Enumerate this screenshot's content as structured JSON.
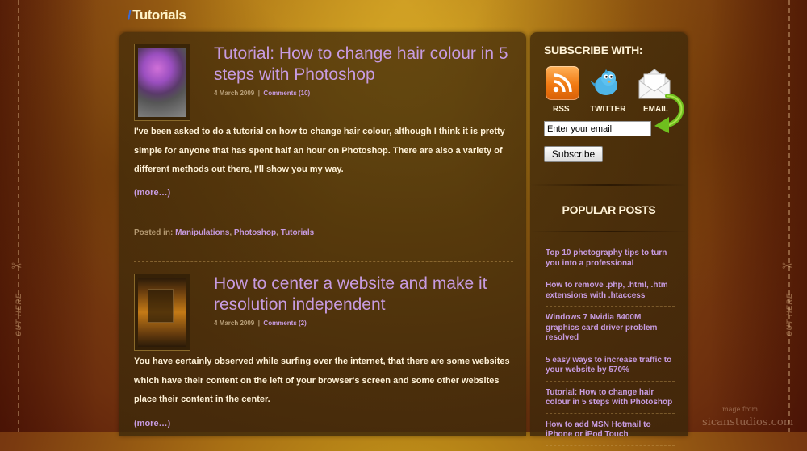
{
  "page": {
    "heading": "Tutorials"
  },
  "posts": [
    {
      "title": "Tutorial: How to change hair colour in 5 steps with Photoshop",
      "date": "4 March 2009",
      "comments": "Comments (10)",
      "excerpt": "I've been asked to do a tutorial on how to change hair colour, although I think it is pretty simple for anyone that has spent half an hour on Photoshop. There are also a variety of different methods out there, I'll show you my way.",
      "more": "(more…)",
      "posted_in_label": "Posted in:",
      "categories": [
        "Manipulations",
        "Photoshop",
        "Tutorials"
      ]
    },
    {
      "title": "How to center a website and make it resolution independent",
      "date": "4 March 2009",
      "comments": "Comments (2)",
      "excerpt": "You have certainly observed while surfing over the internet, that there are some websites which have their content on the left of your browser's screen and some other websites place their content in the center.",
      "more": "(more…)"
    }
  ],
  "sidebar": {
    "subscribe_title": "SUBSCRIBE WITH:",
    "options": {
      "rss": "RSS",
      "twitter": "TWITTER",
      "email": "EMAIL"
    },
    "email_value": "Enter your email",
    "subscribe_button": "Subscribe",
    "popular_title": "POPULAR POSTS",
    "popular_posts": [
      "Top 10 photography tips to turn you into a professional",
      "How to remove .php, .html, .htm extensions with .htaccess",
      "Windows 7 Nvidia 8400M graphics card driver problem resolved",
      "5 easy ways to increase traffic to your website by 570%",
      "Tutorial: How to change hair colour in 5 steps with Photoshop",
      "How to add MSN Hotmail to iPhone or iPod Touch"
    ]
  },
  "decor": {
    "cut_text": "CUT HERE"
  },
  "watermark": {
    "line1": "Image from",
    "line2": "sicanstudios.com"
  },
  "colors": {
    "link": "#c79be0",
    "body_text": "#fff2d8",
    "accent_blue": "#3b6bd8"
  },
  "icons": [
    "rss-icon",
    "twitter-bird-icon",
    "email-envelope-icon",
    "green-curved-arrow-icon",
    "scissors-icon"
  ]
}
